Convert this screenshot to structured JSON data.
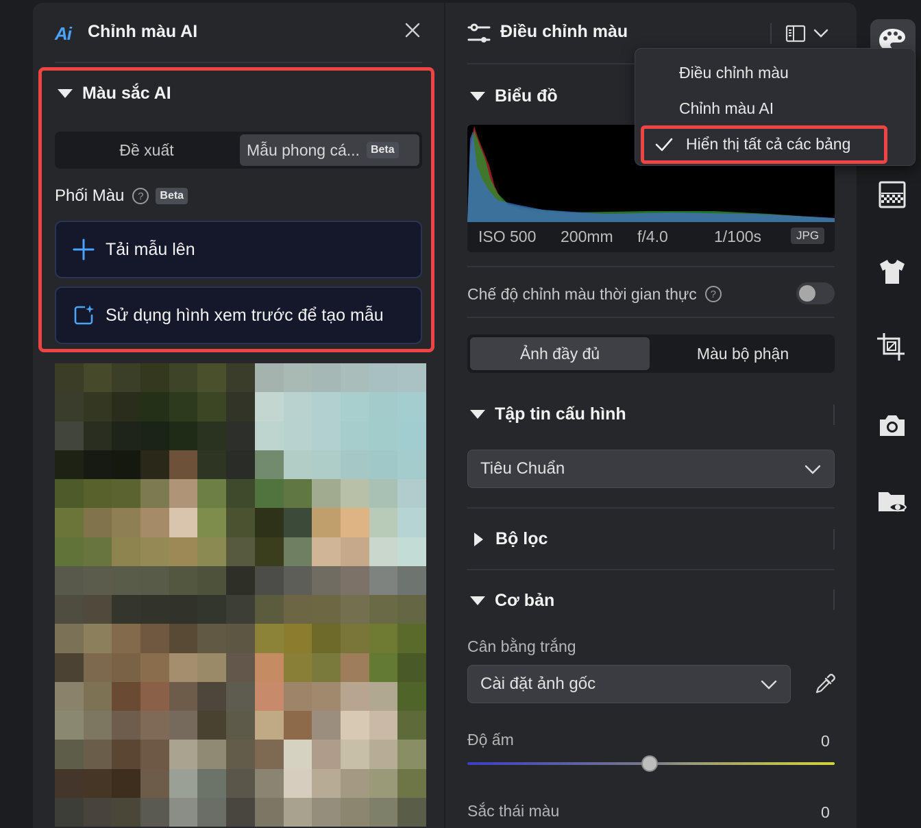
{
  "left_panel": {
    "logo_text": "Ai",
    "title": "Chỉnh màu AI",
    "section_title": "Màu sắc AI",
    "tabs": [
      "Đề xuất",
      "Mẫu phong cá..."
    ],
    "tab_badge": "Beta",
    "mix_title": "Phối Màu",
    "mix_help": "?",
    "mix_badge": "Beta",
    "upload_label": "Tải mẫu lên",
    "preview_label": "Sử dụng hình xem trước để tạo mẫu"
  },
  "right_panel": {
    "title": "Điều chỉnh màu",
    "histogram_title": "Biểu đồ",
    "exif": {
      "iso": "ISO 500",
      "focal": "200mm",
      "aperture": "f/4.0",
      "shutter": "1/100s",
      "format": "JPG"
    },
    "realtime_label": "Chế độ chỉnh màu thời gian thực",
    "realtime_help": "?",
    "realtime_on": false,
    "view_tabs": [
      "Ảnh đầy đủ",
      "Màu bộ phận"
    ],
    "profile_section": "Tập tin cấu hình",
    "profile_value": "Tiêu Chuẩn",
    "filter_section": "Bộ lọc",
    "basic_section": "Cơ bản",
    "wb_label": "Cân bằng trắng",
    "wb_value": "Cài đặt ảnh gốc",
    "warmth_label": "Độ ấm",
    "warmth_value": "0",
    "tint_label": "Sắc thái màu",
    "tint_value": "0"
  },
  "menu": {
    "items": [
      "Điều chỉnh màu",
      "Chỉnh màu AI",
      "Hiển thị tất cả các bảng"
    ],
    "checked_index": 2
  },
  "colors": {
    "accent_red": "#ef4444",
    "accent_blue": "#4aa3ff",
    "panel_bg": "#25272b"
  },
  "tool_rail": [
    "palette-icon",
    "mosaic-icon",
    "tshirt-icon",
    "crop-icon",
    "camera-icon",
    "folder-eye-icon"
  ]
}
